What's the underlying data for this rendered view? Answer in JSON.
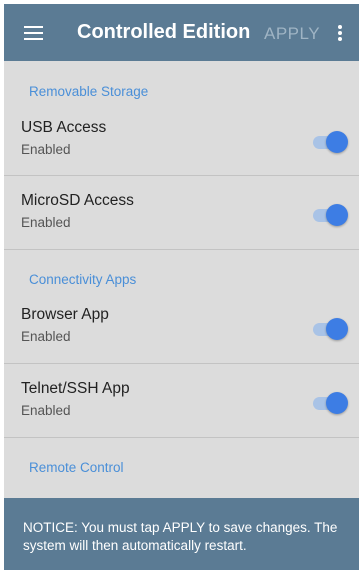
{
  "appbar": {
    "title": "Controlled Edition",
    "apply_label": "APPLY",
    "menu_icon": "hamburger-menu-icon",
    "more_icon": "more-vert-icon"
  },
  "sections": [
    {
      "header": "Removable Storage",
      "items": [
        {
          "name": "USB Access",
          "status": "Enabled",
          "on": true
        },
        {
          "name": "MicroSD Access",
          "status": "Enabled",
          "on": true
        }
      ]
    },
    {
      "header": "Connectivity Apps",
      "items": [
        {
          "name": "Browser App",
          "status": "Enabled",
          "on": true
        },
        {
          "name": "Telnet/SSH App",
          "status": "Enabled",
          "on": true
        }
      ]
    },
    {
      "header": "Remote Control",
      "items": []
    }
  ],
  "notice": {
    "text": "NOTICE: You must tap APPLY to save changes. The system will then automatically restart."
  },
  "colors": {
    "appbar": "#5b7b94",
    "accent": "#3d7de4",
    "section_header": "#4a8fd8",
    "background": "#dcdcdc"
  }
}
